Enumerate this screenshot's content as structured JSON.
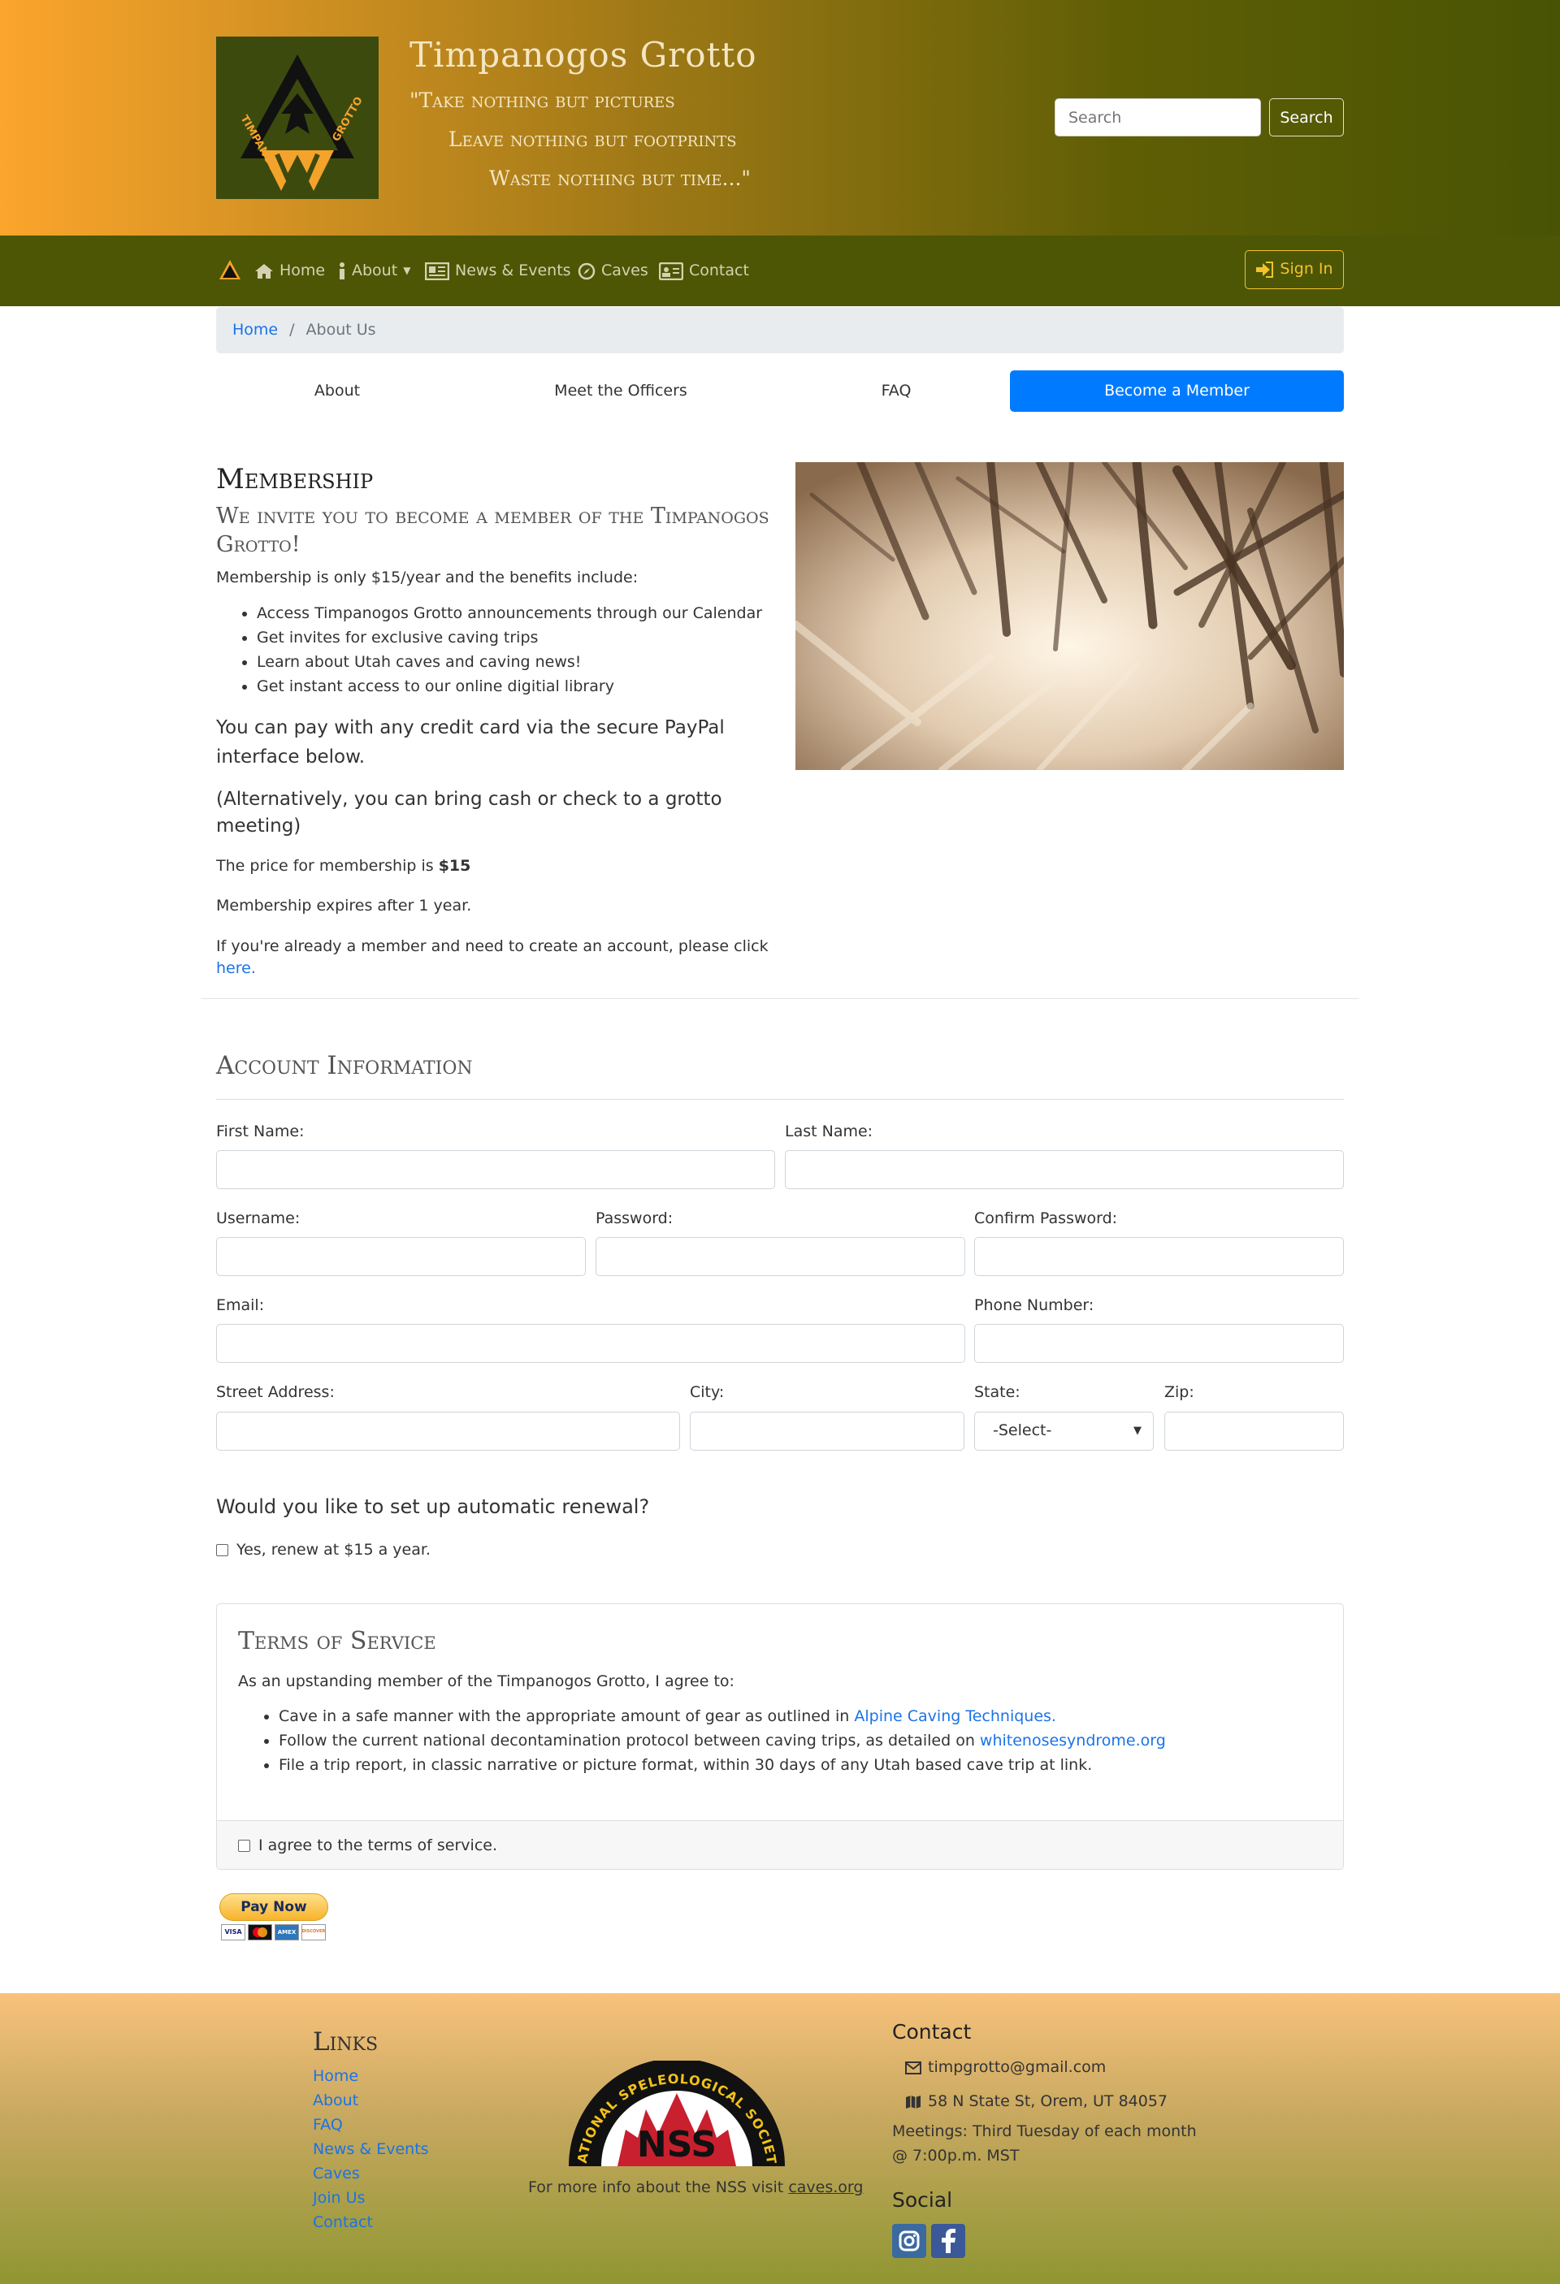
{
  "header": {
    "site_title": "Timpanogos Grotto",
    "tagline_1": "\"Take nothing but pictures",
    "tagline_2": "Leave nothing but footprints",
    "tagline_3": "Waste nothing but time...\"",
    "logo_text_top": "TIMPANOGOS",
    "logo_text_side": "GROTTO",
    "search_placeholder": "Search",
    "search_button": "Search"
  },
  "nav": {
    "home": "Home",
    "about": "About",
    "news": "News & Events",
    "caves": "Caves",
    "contact": "Contact",
    "sign_in": "Sign In"
  },
  "breadcrumb": {
    "home": "Home",
    "separator": "/",
    "current": "About Us"
  },
  "tabs": [
    "About",
    "Meet the Officers",
    "FAQ",
    "Become a Member"
  ],
  "membership": {
    "title": "Membership",
    "subtitle": "We invite you to become a member of the Timpanogos Grotto!",
    "intro": "Membership is only $15/year and the benefits include:",
    "benefits": [
      "Access Timpanogos Grotto announcements through our Calendar",
      "Get invites for exclusive caving trips",
      "Learn about Utah caves and caving news!",
      "Get instant access to our online digitial library"
    ],
    "paypal_note": "You can pay with any credit card via the secure PayPal interface below.",
    "alt_note": "(Alternatively, you can bring cash or check to a grotto meeting)",
    "price_text": "The price for membership is ",
    "price": "$15",
    "expires": "Membership expires after 1 year.",
    "existing_text": "If you're already a member and need to create an account, please click ",
    "existing_link": "here."
  },
  "account": {
    "title": "Account Information",
    "first_name": "First Name:",
    "last_name": "Last Name:",
    "username": "Username:",
    "password": "Password:",
    "confirm_password": "Confirm Password:",
    "email": "Email:",
    "phone": "Phone Number:",
    "street": "Street Address:",
    "city": "City:",
    "state": "State:",
    "state_value": "-Select-",
    "zip": "Zip:"
  },
  "renewal": {
    "question": "Would you like to set up automatic renewal?",
    "checkbox_label": "Yes, renew at $15 a year."
  },
  "terms": {
    "title": "Terms of Service",
    "intro": "As an upstanding member of the Timpanogos Grotto, I agree to:",
    "item1_text": "Cave in a safe manner with the appropriate amount of gear as outlined in ",
    "item1_link": "Alpine Caving Techniques.",
    "item2_text": "Follow the current national decontamination protocol between caving trips, as detailed on ",
    "item2_link": "whitenosesyndrome.org",
    "item3_text": "File a trip report, in classic narrative or picture format, within 30 days of any Utah based cave trip at link.",
    "agree": "I agree to the terms of service."
  },
  "paypal": {
    "button": "Pay Now",
    "cards": [
      "VISA",
      "MC",
      "AMEX",
      "DISCOVER"
    ]
  },
  "footer": {
    "links_title": "Links",
    "links": [
      "Home",
      "About",
      "FAQ",
      "News & Events",
      "Caves",
      "Join Us",
      "Contact"
    ],
    "nss_arc_text": "NATIONAL SPELEOLOGICAL SOCIETY",
    "nss_letters": "NSS",
    "nss_text": "For more info about the NSS visit ",
    "nss_link": "caves.org",
    "contact_title": "Contact",
    "email": "timpgrotto@gmail.com",
    "address": "58 N State St, Orem, UT 84057",
    "meetings": "Meetings: Third Tuesday of each month @ 7:00p.m. MST",
    "social_title": "Social"
  },
  "colors": {
    "header_left": "#fba52c",
    "header_right": "#485404",
    "nav_bg": "#4c5605",
    "accent": "#007bff",
    "signin": "#f4c22a",
    "link": "#1a73e8"
  }
}
